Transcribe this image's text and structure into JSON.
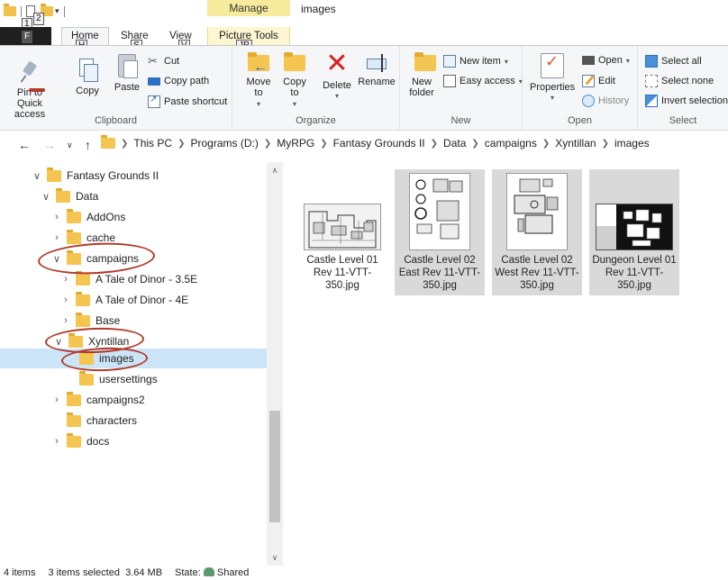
{
  "window": {
    "title": "images",
    "manage_tab": "Manage",
    "picture_tools": "Picture Tools"
  },
  "keytips": {
    "qat1": "1",
    "qat2": "2",
    "file": "F",
    "home": "H",
    "share": "S",
    "view": "V",
    "picture_tools": "JP"
  },
  "tabs": {
    "home": "Home",
    "share": "Share",
    "view": "View"
  },
  "ribbon": {
    "clipboard": {
      "label": "Clipboard",
      "pin": "Pin to Quick access",
      "copy": "Copy",
      "paste": "Paste",
      "cut": "Cut",
      "copy_path": "Copy path",
      "paste_shortcut": "Paste shortcut"
    },
    "organize": {
      "label": "Organize",
      "move_to": "Move to",
      "copy_to": "Copy to",
      "delete": "Delete",
      "rename": "Rename"
    },
    "new": {
      "label": "New",
      "new_folder": "New folder",
      "new_item": "New item",
      "easy_access": "Easy access"
    },
    "open": {
      "label": "Open",
      "properties": "Properties",
      "open": "Open",
      "edit": "Edit",
      "history": "History"
    },
    "select": {
      "label": "Select",
      "select_all": "Select all",
      "select_none": "Select none",
      "invert": "Invert selection"
    }
  },
  "address": {
    "crumbs": [
      "This PC",
      "Programs (D:)",
      "MyRPG",
      "Fantasy Grounds II",
      "Data",
      "campaigns",
      "Xyntillan",
      "images"
    ]
  },
  "tree": [
    {
      "label": "Fantasy Grounds II",
      "chevron": "expanded"
    },
    {
      "label": "Data",
      "chevron": "expanded"
    },
    {
      "label": "AddOns",
      "chevron": "collapsed"
    },
    {
      "label": "cache",
      "chevron": "collapsed"
    },
    {
      "label": "campaigns",
      "chevron": "expanded"
    },
    {
      "label": "A Tale of Dinor - 3.5E",
      "chevron": "collapsed"
    },
    {
      "label": "A Tale of Dinor - 4E",
      "chevron": "collapsed"
    },
    {
      "label": "Base",
      "chevron": "collapsed"
    },
    {
      "label": "Xyntillan",
      "chevron": "expanded"
    },
    {
      "label": "images",
      "chevron": "none"
    },
    {
      "label": "usersettings",
      "chevron": "none"
    },
    {
      "label": "campaigns2",
      "chevron": "collapsed"
    },
    {
      "label": "characters",
      "chevron": "none"
    },
    {
      "label": "docs",
      "chevron": "collapsed"
    }
  ],
  "files": [
    {
      "name": "Castle Level 01 Rev 11-VTT-350.jpg",
      "selected": false
    },
    {
      "name": "Castle Level 02 East Rev 11-VTT-350.jpg",
      "selected": true
    },
    {
      "name": "Castle Level 02 West Rev 11-VTT-350.jpg",
      "selected": true
    },
    {
      "name": "Dungeon Level 01 Rev 11-VTT-350.jpg",
      "selected": true
    }
  ],
  "status": {
    "items": "4 items",
    "selected": "3 items selected  3.64 MB",
    "state": "State:",
    "shared": "Shared"
  },
  "colors": {
    "accent_selection": "#cce4f7",
    "manage_tab": "#f6ea9c",
    "annotation": "#b23a2a",
    "delete_red": "#d81e1e"
  }
}
